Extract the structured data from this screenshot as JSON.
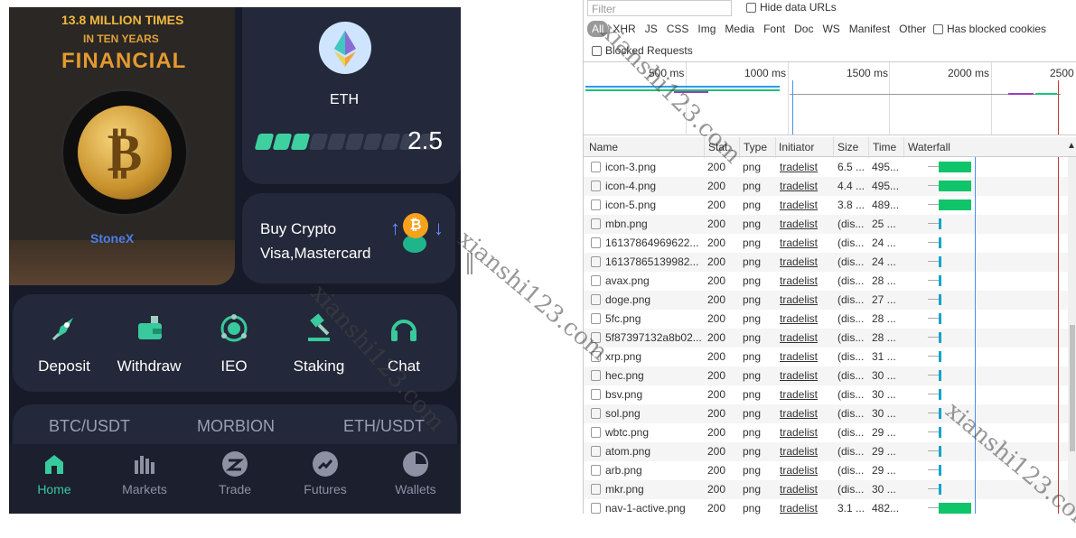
{
  "app": {
    "banner": {
      "line1": "13.8 MILLION TIMES",
      "line2": "IN TEN YEARS",
      "line3": "FINANCIAL",
      "brand": "StoneX"
    },
    "eth_card": {
      "symbol": "ETH",
      "value": "2.5",
      "bar_fill": 0.3
    },
    "buy_card": {
      "line1": "Buy Crypto",
      "line2": "Visa,Mastercard"
    },
    "actions": [
      {
        "label": "Deposit",
        "icon": "rocket-icon"
      },
      {
        "label": "Withdraw",
        "icon": "wallet-icon"
      },
      {
        "label": "IEO",
        "icon": "ieo-icon"
      },
      {
        "label": "Staking",
        "icon": "gavel-icon"
      },
      {
        "label": "Chat",
        "icon": "headset-icon"
      }
    ],
    "ticker": [
      "BTC/USDT",
      "MORBION",
      "ETH/USDT"
    ],
    "nav": [
      {
        "label": "Home",
        "icon": "home-icon",
        "active": true
      },
      {
        "label": "Markets",
        "icon": "bars-icon",
        "active": false
      },
      {
        "label": "Trade",
        "icon": "trade-icon",
        "active": false
      },
      {
        "label": "Futures",
        "icon": "futures-icon",
        "active": false
      },
      {
        "label": "Wallets",
        "icon": "pie-icon",
        "active": false
      }
    ],
    "colors": {
      "accent": "#38c99d",
      "bg": "#171b29",
      "card": "#23283a"
    }
  },
  "devtools": {
    "filter_placeholder": "Filter",
    "hide_data_urls": "Hide data URLs",
    "types": [
      "All",
      "XHR",
      "JS",
      "CSS",
      "Img",
      "Media",
      "Font",
      "Doc",
      "WS",
      "Manifest",
      "Other"
    ],
    "has_blocked_cookies": "Has blocked cookies",
    "blocked_requests": "Blocked Requests",
    "ticks": [
      "500 ms",
      "1000 ms",
      "1500 ms",
      "2000 ms",
      "2500"
    ],
    "columns": [
      "Name",
      "Stat..",
      "Type",
      "Initiator",
      "Size",
      "Time",
      "Waterfall"
    ],
    "rows": [
      {
        "name": "icon-3.png",
        "status": "200",
        "type": "png",
        "initiator": "tradelist",
        "size": "6.5 ...",
        "time": "495...",
        "big": true
      },
      {
        "name": "icon-4.png",
        "status": "200",
        "type": "png",
        "initiator": "tradelist",
        "size": "4.4 ...",
        "time": "495...",
        "big": true
      },
      {
        "name": "icon-5.png",
        "status": "200",
        "type": "png",
        "initiator": "tradelist",
        "size": "3.8 ...",
        "time": "489...",
        "big": true
      },
      {
        "name": "mbn.png",
        "status": "200",
        "type": "png",
        "initiator": "tradelist",
        "size": "(dis...",
        "time": "25 ...",
        "big": false
      },
      {
        "name": "16137864969622...",
        "status": "200",
        "type": "png",
        "initiator": "tradelist",
        "size": "(dis...",
        "time": "24 ...",
        "big": false
      },
      {
        "name": "16137865139982...",
        "status": "200",
        "type": "png",
        "initiator": "tradelist",
        "size": "(dis...",
        "time": "24 ...",
        "big": false
      },
      {
        "name": "avax.png",
        "status": "200",
        "type": "png",
        "initiator": "tradelist",
        "size": "(dis...",
        "time": "28 ...",
        "big": false
      },
      {
        "name": "doge.png",
        "status": "200",
        "type": "png",
        "initiator": "tradelist",
        "size": "(dis...",
        "time": "27 ...",
        "big": false
      },
      {
        "name": "5fc.png",
        "status": "200",
        "type": "png",
        "initiator": "tradelist",
        "size": "(dis...",
        "time": "28 ...",
        "big": false
      },
      {
        "name": "5f87397132a8b02...",
        "status": "200",
        "type": "png",
        "initiator": "tradelist",
        "size": "(dis...",
        "time": "28 ...",
        "big": false
      },
      {
        "name": "xrp.png",
        "status": "200",
        "type": "png",
        "initiator": "tradelist",
        "size": "(dis...",
        "time": "31 ...",
        "big": false
      },
      {
        "name": "hec.png",
        "status": "200",
        "type": "png",
        "initiator": "tradelist",
        "size": "(dis...",
        "time": "30 ...",
        "big": false
      },
      {
        "name": "bsv.png",
        "status": "200",
        "type": "png",
        "initiator": "tradelist",
        "size": "(dis...",
        "time": "30 ...",
        "big": false
      },
      {
        "name": "sol.png",
        "status": "200",
        "type": "png",
        "initiator": "tradelist",
        "size": "(dis...",
        "time": "30 ...",
        "big": false
      },
      {
        "name": "wbtc.png",
        "status": "200",
        "type": "png",
        "initiator": "tradelist",
        "size": "(dis...",
        "time": "29 ...",
        "big": false
      },
      {
        "name": "atom.png",
        "status": "200",
        "type": "png",
        "initiator": "tradelist",
        "size": "(dis...",
        "time": "29 ...",
        "big": false
      },
      {
        "name": "arb.png",
        "status": "200",
        "type": "png",
        "initiator": "tradelist",
        "size": "(dis...",
        "time": "29 ...",
        "big": false
      },
      {
        "name": "mkr.png",
        "status": "200",
        "type": "png",
        "initiator": "tradelist",
        "size": "(dis...",
        "time": "30 ...",
        "big": false
      },
      {
        "name": "nav-1-active.png",
        "status": "200",
        "type": "png",
        "initiator": "tradelist",
        "size": "3.1 ...",
        "time": "482...",
        "big": true
      }
    ]
  },
  "watermark": "xianshi123.com"
}
